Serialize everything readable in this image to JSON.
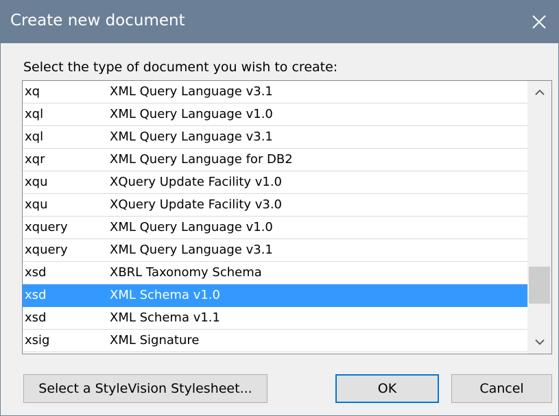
{
  "window": {
    "title": "Create new document",
    "close_icon": "close-icon"
  },
  "prompt": "Select the type of document you wish to create:",
  "document_types": [
    {
      "ext": "xq",
      "desc": "XML Query Language v3.1"
    },
    {
      "ext": "xql",
      "desc": "XML Query Language v1.0"
    },
    {
      "ext": "xql",
      "desc": "XML Query Language v3.1"
    },
    {
      "ext": "xqr",
      "desc": "XML Query Language for DB2"
    },
    {
      "ext": "xqu",
      "desc": "XQuery Update Facility v1.0"
    },
    {
      "ext": "xqu",
      "desc": "XQuery Update Facility v3.0"
    },
    {
      "ext": "xquery",
      "desc": "XML Query Language v1.0"
    },
    {
      "ext": "xquery",
      "desc": "XML Query Language v3.1"
    },
    {
      "ext": "xsd",
      "desc": "XBRL Taxonomy Schema"
    },
    {
      "ext": "xsd",
      "desc": "XML Schema v1.0",
      "selected": true
    },
    {
      "ext": "xsd",
      "desc": "XML Schema v1.1"
    },
    {
      "ext": "xsig",
      "desc": "XML Signature"
    }
  ],
  "buttons": {
    "stylevision": "Select a StyleVision Stylesheet...",
    "ok": "OK",
    "cancel": "Cancel"
  },
  "colors": {
    "titlebar": "#6b7f96",
    "selection": "#3399ff",
    "default_button_border": "#0078d7"
  }
}
